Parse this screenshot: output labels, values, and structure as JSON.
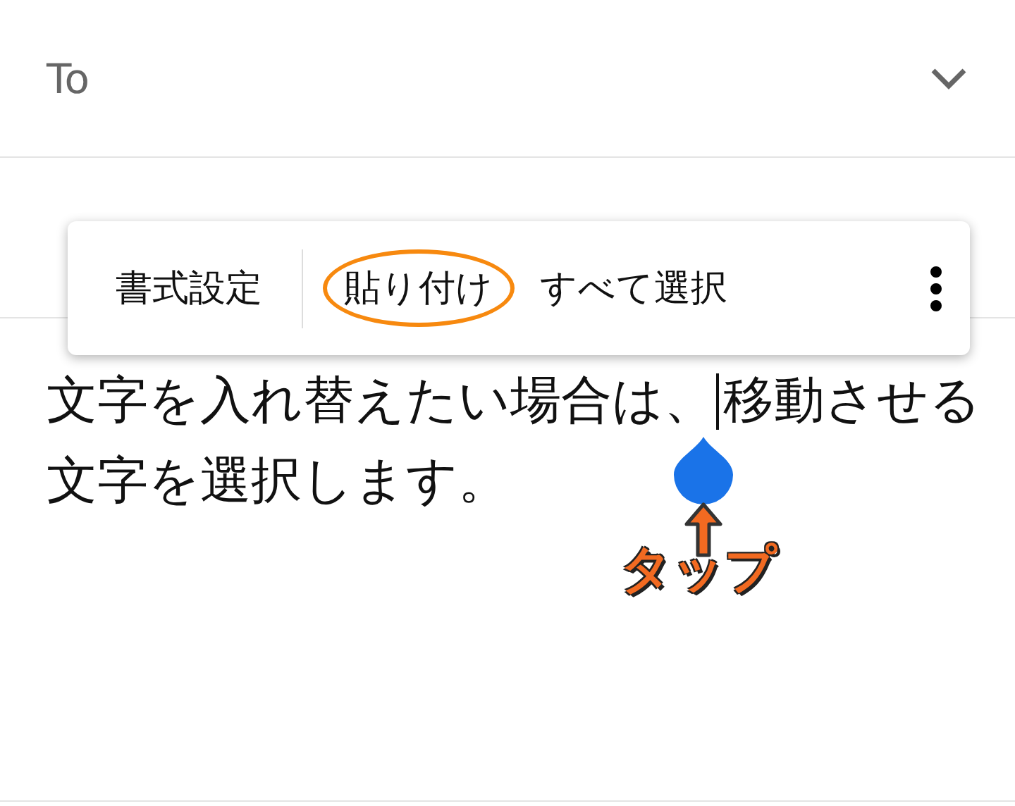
{
  "to_field": {
    "label": "To"
  },
  "context_menu": {
    "items": [
      {
        "label": "書式設定",
        "circled": false
      },
      {
        "label": "貼り付け",
        "circled": true
      },
      {
        "label": "すべて選択",
        "circled": false
      }
    ]
  },
  "body": {
    "before_cursor": "文字を入れ替えたい場合は、",
    "after_cursor": "移動させる",
    "next_line": "文字を選択します。"
  },
  "annotation": {
    "label": "タップ"
  }
}
